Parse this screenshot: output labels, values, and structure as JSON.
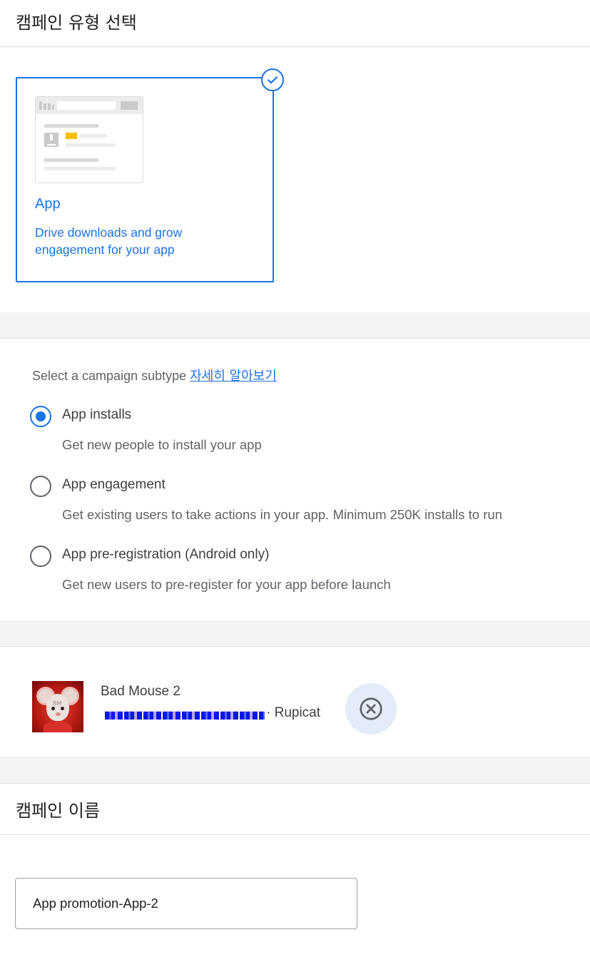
{
  "campaign_type": {
    "header": "캠페인 유형 선택",
    "card": {
      "title": "App",
      "description": "Drive downloads and grow engagement for your app",
      "selected": true
    }
  },
  "subtype": {
    "label": "Select a campaign subtype",
    "learn_more": "자세히 알아보기",
    "options": [
      {
        "title": "App installs",
        "description": "Get new people to install your app",
        "checked": true
      },
      {
        "title": "App engagement",
        "description": "Get existing users to take actions in your app. Minimum 250K installs to run",
        "checked": false
      },
      {
        "title": "App pre-registration (Android only)",
        "description": "Get new users to pre-register for your app before launch",
        "checked": false
      }
    ]
  },
  "app": {
    "name": "Bad Mouse 2",
    "developer": "· Rupicat",
    "icon": "bad-mouse-app-icon",
    "remove_icon": "close-circle-icon"
  },
  "campaign_name": {
    "header": "캠페인 이름",
    "value": "App promotion-App-2"
  },
  "colors": {
    "accent": "#1a73e8",
    "gap": "#f1f3f4"
  }
}
